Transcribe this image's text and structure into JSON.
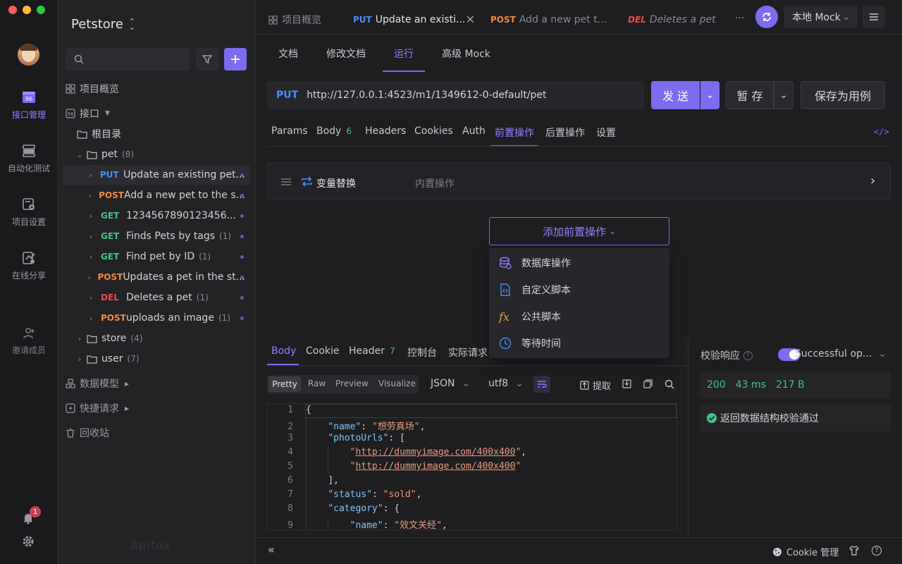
{
  "window": {
    "traffic": [
      "#ff5f57",
      "#febc2e",
      "#28c840"
    ]
  },
  "rail": {
    "items": [
      {
        "label": "接口管理",
        "icon": "api-icon"
      },
      {
        "label": "自动化测试",
        "icon": "automation-icon"
      },
      {
        "label": "项目设置",
        "icon": "settings-doc-icon"
      },
      {
        "label": "在线分享",
        "icon": "share-icon"
      },
      {
        "label": "邀请成员",
        "icon": "invite-icon"
      }
    ],
    "notification_count": "1",
    "watermark": "Apifox"
  },
  "sidebar": {
    "project_name": "Petstore",
    "search_placeholder": "",
    "overview": "项目概览",
    "api_section": "接口",
    "root": "根目录",
    "pet_folder": {
      "name": "pet",
      "count": "(8)"
    },
    "endpoints": [
      {
        "method": "PUT",
        "name": "Update an existing pet...",
        "count": "",
        "active": true
      },
      {
        "method": "POST",
        "name": "Add a new pet to the s...",
        "count": ""
      },
      {
        "method": "GET",
        "name": "1234567890123456...",
        "count": ""
      },
      {
        "method": "GET",
        "name": "Finds Pets by tags",
        "count": "(1)"
      },
      {
        "method": "GET",
        "name": "Find pet by ID",
        "count": "(1)"
      },
      {
        "method": "POST",
        "name": "Updates a pet in the st...",
        "count": ""
      },
      {
        "method": "DEL",
        "name": "Deletes a pet",
        "count": "(1)"
      },
      {
        "method": "POST",
        "name": "uploads an image",
        "count": "(1)"
      }
    ],
    "folders": [
      {
        "name": "store",
        "count": "(4)"
      },
      {
        "name": "user",
        "count": "(7)"
      }
    ],
    "data_model": "数据模型",
    "quick_request": "快捷请求",
    "recycle_bin": "回收站"
  },
  "tabs": {
    "overview": "项目概览",
    "items": [
      {
        "method": "PUT",
        "title": "Update an existi..."
      },
      {
        "method": "POST",
        "title": "Add a new pet t..."
      },
      {
        "method": "DEL",
        "title": "Deletes a pet"
      }
    ],
    "more": "···",
    "env": "本地 Mock"
  },
  "subtabs": [
    "文档",
    "修改文档",
    "运行",
    "高级 Mock"
  ],
  "request": {
    "method": "PUT",
    "url": "http://127.0.0.1:4523/m1/1349612-0-default/pet",
    "send": "发 送",
    "save": "暂 存",
    "save_as_case": "保存为用例"
  },
  "req_tabs": {
    "params": "Params",
    "body": "Body",
    "body_count": "6",
    "headers": "Headers",
    "cookies": "Cookies",
    "auth": "Auth",
    "pre": "前置操作",
    "post": "后置操作",
    "settings": "设置"
  },
  "pre_ops": {
    "item_name": "变量替换",
    "item_type": "内置操作",
    "add_button": "添加前置操作",
    "menu": [
      {
        "label": "数据库操作",
        "icon": "database-icon"
      },
      {
        "label": "自定义脚本",
        "icon": "script-file-icon"
      },
      {
        "label": "公共脚本",
        "icon": "fx-icon"
      },
      {
        "label": "等待时间",
        "icon": "clock-icon"
      }
    ]
  },
  "response": {
    "tabs": {
      "body": "Body",
      "cookie": "Cookie",
      "header": "Header",
      "header_count": "7",
      "console": "控制台",
      "actual": "实际请求"
    },
    "view_modes": [
      "Pretty",
      "Raw",
      "Preview",
      "Visualize"
    ],
    "format": "JSON",
    "encoding": "utf8",
    "extract": "提取",
    "code_lines": [
      {
        "n": "1",
        "indent": 0,
        "parts": [
          [
            "p",
            "{"
          ]
        ]
      },
      {
        "n": "2",
        "indent": 1,
        "parts": [
          [
            "k",
            "\"name\""
          ],
          [
            "p",
            ": "
          ],
          [
            "s",
            "\"想劳真场\""
          ],
          [
            "p",
            ","
          ]
        ]
      },
      {
        "n": "3",
        "indent": 1,
        "parts": [
          [
            "k",
            "\"photoUrls\""
          ],
          [
            "p",
            ": ["
          ]
        ]
      },
      {
        "n": "4",
        "indent": 2,
        "parts": [
          [
            "s",
            "\""
          ],
          [
            "u",
            "http://dummyimage.com/400x400"
          ],
          [
            "s",
            "\""
          ],
          [
            "p",
            ","
          ]
        ]
      },
      {
        "n": "5",
        "indent": 2,
        "parts": [
          [
            "s",
            "\""
          ],
          [
            "u",
            "http://dummyimage.com/400x400"
          ],
          [
            "s",
            "\""
          ]
        ]
      },
      {
        "n": "6",
        "indent": 1,
        "parts": [
          [
            "p",
            "],"
          ]
        ]
      },
      {
        "n": "7",
        "indent": 1,
        "parts": [
          [
            "k",
            "\"status\""
          ],
          [
            "p",
            ": "
          ],
          [
            "s",
            "\"sold\""
          ],
          [
            "p",
            ","
          ]
        ]
      },
      {
        "n": "8",
        "indent": 1,
        "parts": [
          [
            "k",
            "\"category\""
          ],
          [
            "p",
            ": {"
          ]
        ]
      },
      {
        "n": "9",
        "indent": 2,
        "parts": [
          [
            "k",
            "\"name\""
          ],
          [
            "p",
            ": "
          ],
          [
            "s",
            "\"效文关经\""
          ],
          [
            "p",
            ","
          ]
        ]
      }
    ]
  },
  "validation": {
    "label": "校验响应",
    "select": "Successful op...",
    "status": "200",
    "time": "43 ms",
    "size": "217 B",
    "result": "返回数据结构校验通过"
  },
  "footer": {
    "cookie_manager": "Cookie 管理"
  },
  "colors": {
    "accent": "#7b6cf0",
    "accent_text": "#8f80ff",
    "success": "#45c386"
  }
}
